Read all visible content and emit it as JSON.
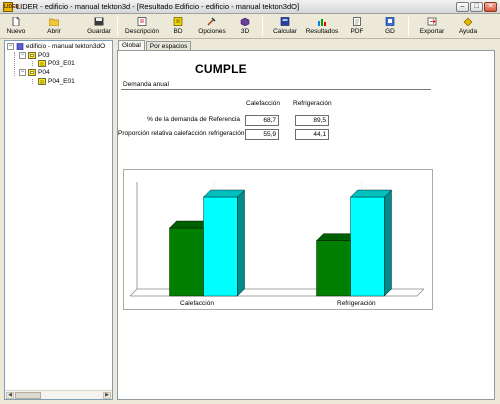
{
  "window": {
    "app_icon_text": "LIDER",
    "title": "LIDER - edificio - manual tekton3d - [Resultado Edificio - edificio - manual tekton3dO]",
    "controls": [
      "minimize",
      "maximize",
      "close"
    ]
  },
  "toolbar": {
    "buttons": [
      {
        "label": "Nuevo",
        "icon": "new-file-icon"
      },
      {
        "label": "Abrir",
        "icon": "folder-open-icon"
      },
      {
        "label": "Guardar",
        "icon": "save-disk-icon"
      },
      {
        "label": "Descripción",
        "icon": "description-icon"
      },
      {
        "label": "BD",
        "icon": "database-icon"
      },
      {
        "label": "Opciones",
        "icon": "tools-icon"
      },
      {
        "label": "3D",
        "icon": "3d-view-icon"
      },
      {
        "label": "Calcular",
        "icon": "calculate-icon"
      },
      {
        "label": "Resultados",
        "icon": "results-chart-icon"
      },
      {
        "label": "PDF",
        "icon": "pdf-icon"
      },
      {
        "label": "GD",
        "icon": "gd-icon"
      },
      {
        "label": "Exportar",
        "icon": "export-icon"
      },
      {
        "label": "Ayuda",
        "icon": "help-icon"
      }
    ]
  },
  "tree": {
    "root": "edificio - manual tekton3dO",
    "floors": [
      {
        "label": "P03",
        "space": "P03_E01"
      },
      {
        "label": "P04",
        "space": "P04_E01"
      }
    ]
  },
  "tabs": [
    {
      "label": "Global",
      "active": true
    },
    {
      "label": "Por espacios",
      "active": false
    }
  ],
  "result": {
    "status": "CUMPLE",
    "section": "Demanda anual",
    "columns": [
      "Calefacción",
      "Refrigeración"
    ],
    "rows": [
      {
        "label": "% de la demanda de Referencia",
        "values": [
          "68,7",
          "89,5"
        ]
      },
      {
        "label": "Proporción relativa calefacción refrigeración",
        "values": [
          "55,9",
          "44,1"
        ]
      }
    ]
  },
  "chart_data": {
    "type": "bar",
    "categories": [
      "Calefacción",
      "Refrigeración"
    ],
    "series": [
      {
        "name": "",
        "values": [
          68.7,
          55.9
        ],
        "color": "#007f00"
      },
      {
        "name": "",
        "values": [
          100,
          100
        ],
        "color": "#00ffff"
      }
    ],
    "ylim": [
      0,
      100
    ],
    "grid": false,
    "note": "3D clustered bars; second series heights relative"
  }
}
